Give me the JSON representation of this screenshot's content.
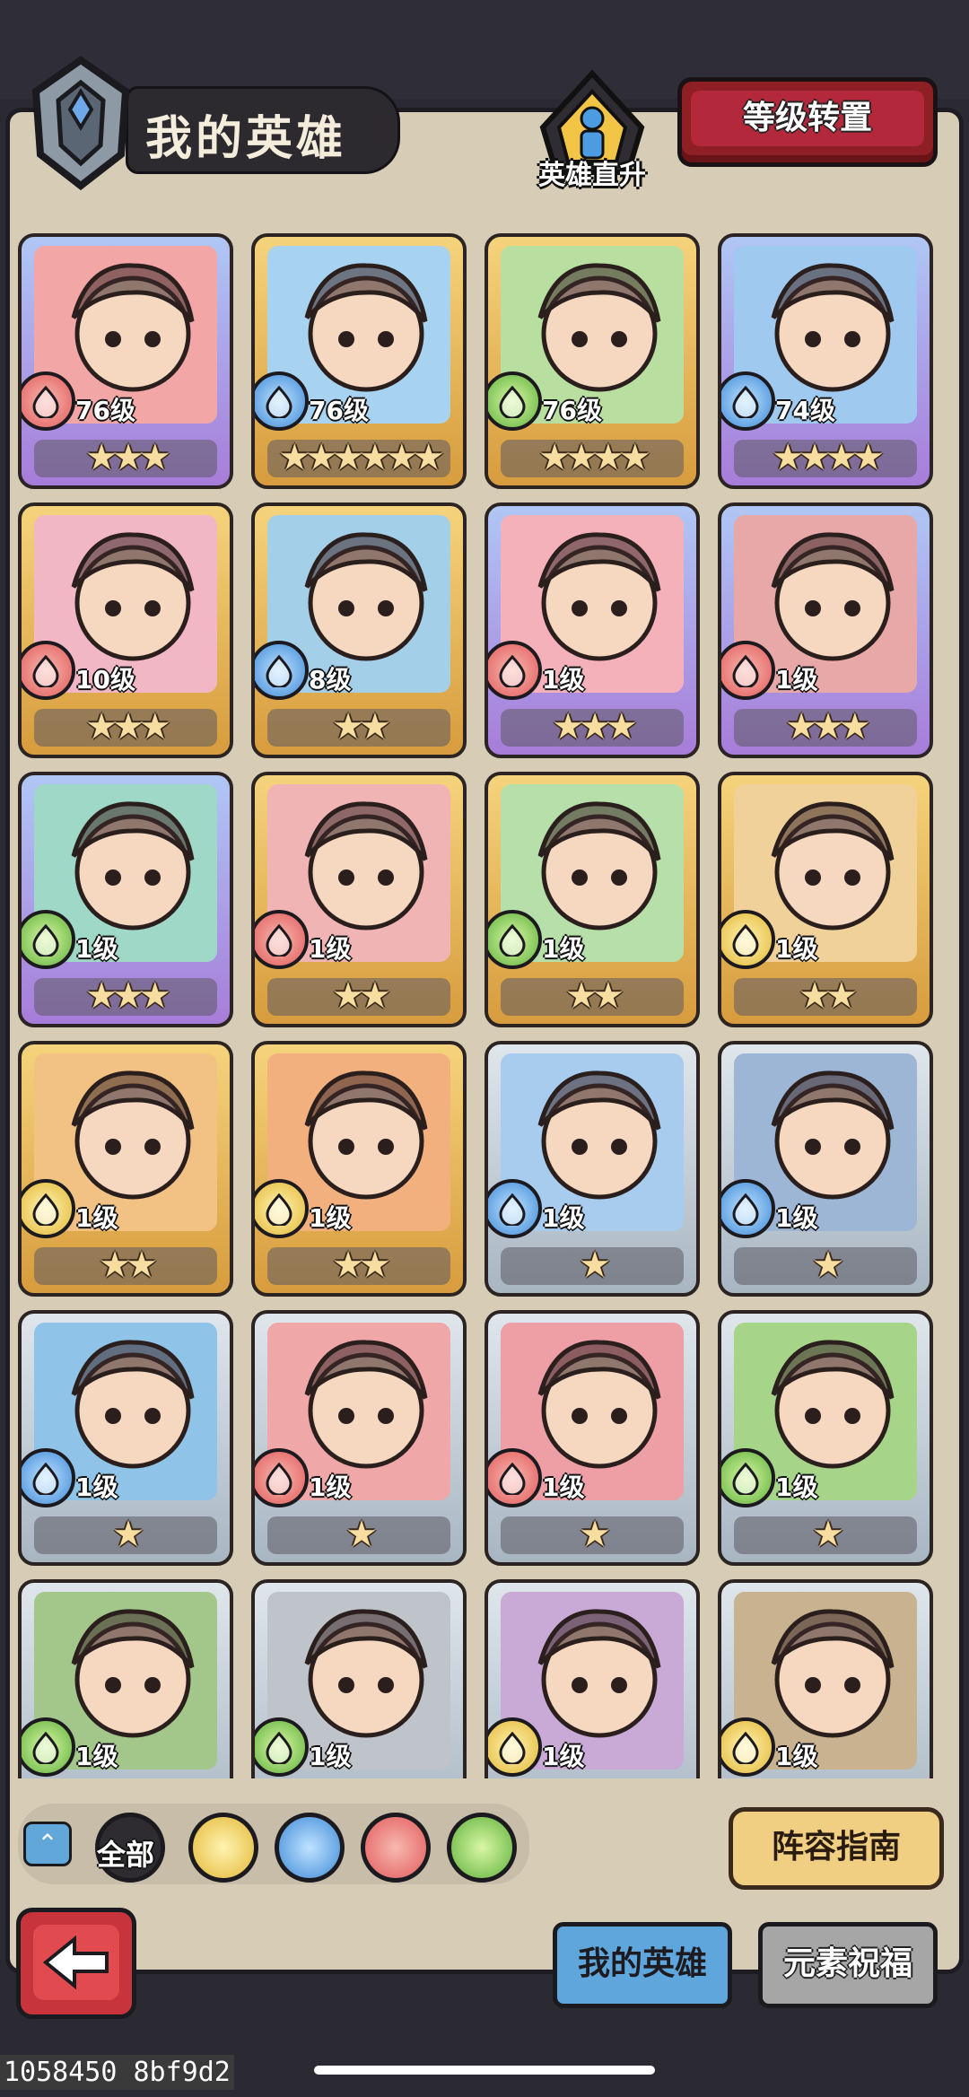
{
  "header": {
    "title": "我的英雄",
    "hero_rise_label": "英雄直升",
    "level_reset_label": "等级转置"
  },
  "heroes": [
    {
      "level": "76级",
      "stars": "★★★",
      "element": "fire",
      "rarity": "purple"
    },
    {
      "level": "76级",
      "stars": "★★★★★★",
      "element": "water",
      "rarity": "gold"
    },
    {
      "level": "76级",
      "stars": "★★★★",
      "element": "wood",
      "rarity": "gold"
    },
    {
      "level": "74级",
      "stars": "★★★★",
      "element": "water",
      "rarity": "purple"
    },
    {
      "level": "10级",
      "stars": "★★★",
      "element": "fire",
      "rarity": "gold"
    },
    {
      "level": "8级",
      "stars": "★★",
      "element": "water",
      "rarity": "gold"
    },
    {
      "level": "1级",
      "stars": "★★★",
      "element": "fire",
      "rarity": "purple"
    },
    {
      "level": "1级",
      "stars": "★★★",
      "element": "fire",
      "rarity": "purple"
    },
    {
      "level": "1级",
      "stars": "★★★",
      "element": "wood",
      "rarity": "purple"
    },
    {
      "level": "1级",
      "stars": "★★",
      "element": "fire",
      "rarity": "gold"
    },
    {
      "level": "1级",
      "stars": "★★",
      "element": "wood",
      "rarity": "gold"
    },
    {
      "level": "1级",
      "stars": "★★",
      "element": "earth",
      "rarity": "gold"
    },
    {
      "level": "1级",
      "stars": "★★",
      "element": "earth",
      "rarity": "gold"
    },
    {
      "level": "1级",
      "stars": "★★",
      "element": "earth",
      "rarity": "gold"
    },
    {
      "level": "1级",
      "stars": "★",
      "element": "water",
      "rarity": "silver"
    },
    {
      "level": "1级",
      "stars": "★",
      "element": "water",
      "rarity": "silver"
    },
    {
      "level": "1级",
      "stars": "★",
      "element": "water",
      "rarity": "silver"
    },
    {
      "level": "1级",
      "stars": "★",
      "element": "fire",
      "rarity": "silver"
    },
    {
      "level": "1级",
      "stars": "★",
      "element": "fire",
      "rarity": "silver"
    },
    {
      "level": "1级",
      "stars": "★",
      "element": "wood",
      "rarity": "silver"
    },
    {
      "level": "1级",
      "stars": "",
      "element": "wood",
      "rarity": "silver"
    },
    {
      "level": "1级",
      "stars": "",
      "element": "wood",
      "rarity": "silver"
    },
    {
      "level": "1级",
      "stars": "",
      "element": "earth",
      "rarity": "silver"
    },
    {
      "level": "1级",
      "stars": "",
      "element": "earth",
      "rarity": "silver"
    }
  ],
  "filters": {
    "all_label": "全部",
    "options": [
      "earth-icon",
      "water-icon",
      "fire-icon",
      "wood-icon"
    ]
  },
  "formation_guide_label": "阵容指南",
  "tabs": {
    "my_heroes": "我的英雄",
    "element_blessing": "元素祝福"
  },
  "debug_text": "1058450 8bf9d2",
  "colors": {
    "fire": "#e25b5b",
    "water": "#3f8ad8",
    "wood": "#5fb13a",
    "earth": "#e3b838",
    "accent_red": "#8e1f24",
    "accent_blue": "#5ea6db"
  }
}
